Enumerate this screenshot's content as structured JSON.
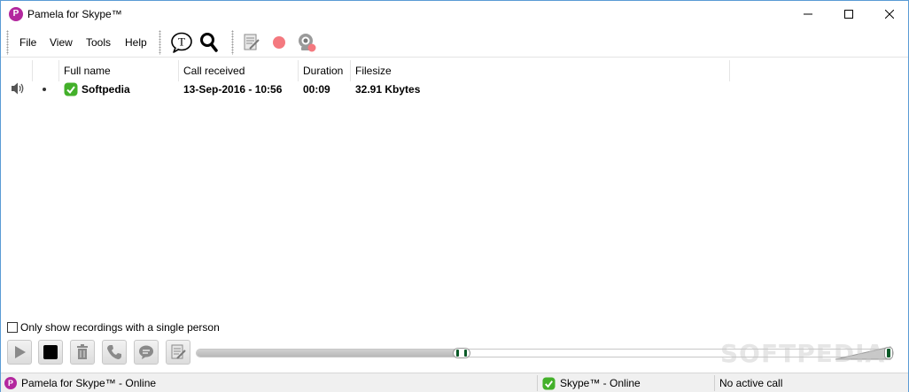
{
  "window": {
    "title": "Pamela for Skype™",
    "logo_letter": "P"
  },
  "menu": {
    "items": [
      "File",
      "View",
      "Tools",
      "Help"
    ]
  },
  "toolbar": {
    "icons": [
      "chat-bubble-t-icon",
      "search-icon",
      "notes-icon",
      "record-icon",
      "webcam-record-icon"
    ],
    "record_color": "#f4797f"
  },
  "table": {
    "columns": [
      "Full name",
      "Call received",
      "Duration",
      "Filesize"
    ],
    "rows": [
      {
        "full_name": "Softpedia",
        "call_received": "13-Sep-2016 - 10:56",
        "duration": "00:09",
        "filesize": "32.91 Kbytes"
      }
    ]
  },
  "filter": {
    "single_person_label": "Only show recordings with a single person",
    "checked": false
  },
  "player": {
    "progress": 0.38,
    "volume": 1.0
  },
  "watermark": "SOFTPEDIA",
  "statusbar": {
    "app_status": "Pamela for Skype™ - Online",
    "skype_status": "Skype™ - Online",
    "call_status": "No active call"
  },
  "colors": {
    "brand": "#b3279e",
    "online_green": "#43b02a",
    "handle_green": "#0a5a28"
  }
}
